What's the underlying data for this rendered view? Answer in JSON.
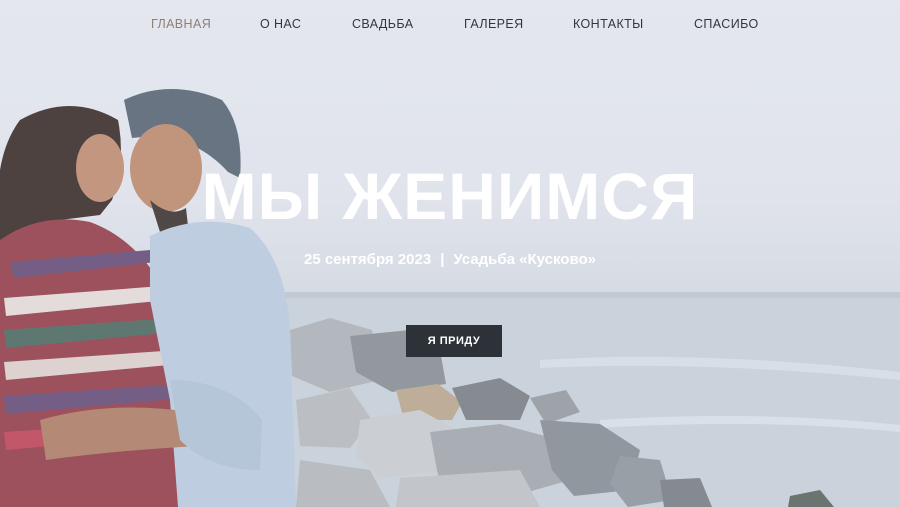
{
  "nav": {
    "items": [
      {
        "label": "ГЛАВНАЯ",
        "active": true
      },
      {
        "label": "О НАС",
        "active": false
      },
      {
        "label": "СВАДЬБА",
        "active": false
      },
      {
        "label": "ГАЛЕРЕЯ",
        "active": false
      },
      {
        "label": "КОНТАКТЫ",
        "active": false
      },
      {
        "label": "СПАСИБО",
        "active": false
      }
    ]
  },
  "hero": {
    "headline": "МЫ ЖЕНИМСЯ",
    "date": "25 сентября 2023",
    "separator": "|",
    "venue": "Усадьба «Кусково»",
    "rsvp_label": "Я ПРИДУ"
  },
  "colors": {
    "nav_text": "#33373c",
    "nav_active": "#8d7f74",
    "button_bg": "#2c3238",
    "headline": "#ffffff"
  }
}
